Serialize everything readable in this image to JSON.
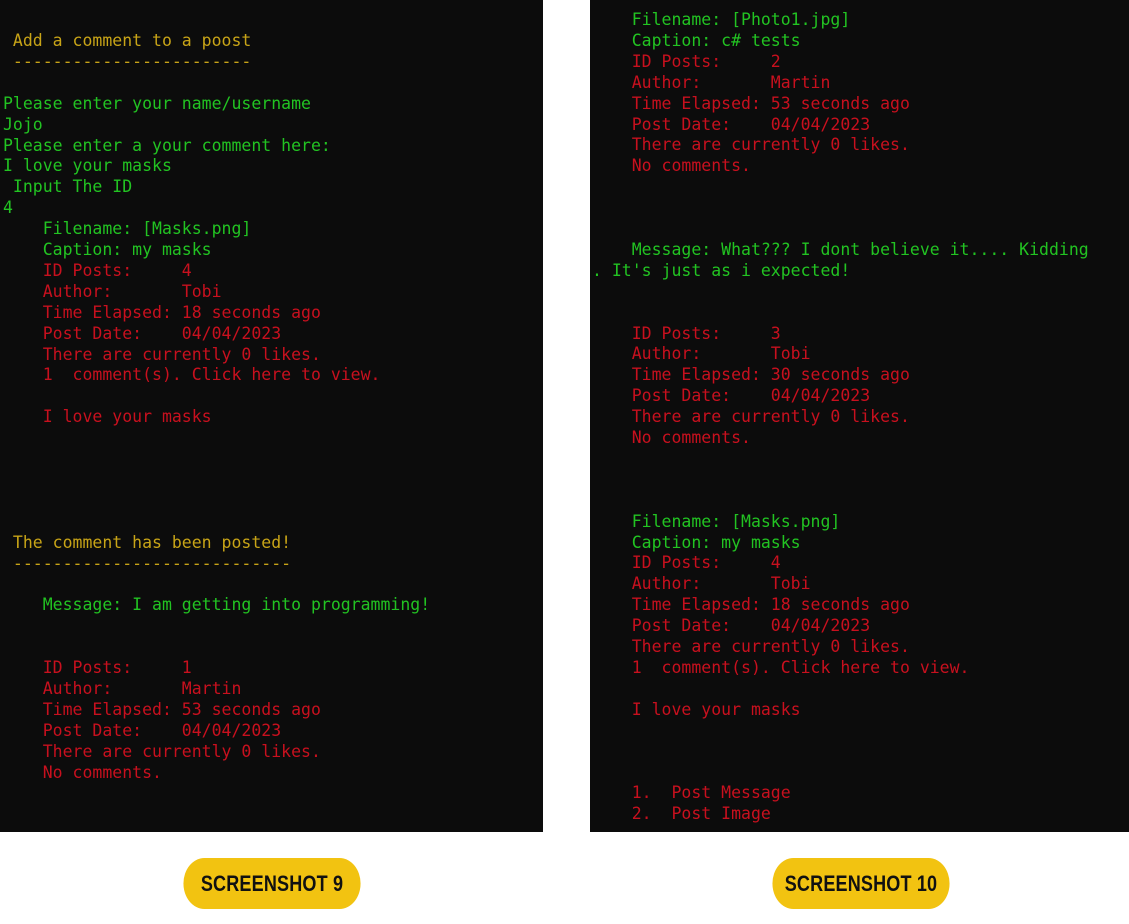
{
  "colors": {
    "console_background": "#0c0c0c",
    "heading": "#c8a417",
    "input_text": "#22c322",
    "post_text": "#c8101e",
    "badge": "#f2c311"
  },
  "screenshot9": {
    "label": "SCREENSHOT 9",
    "lines": [
      {
        "text": " Add a comment to a poost",
        "color": "yellow"
      },
      {
        "text": " ------------------------",
        "color": "yellow"
      },
      {
        "text": "",
        "color": "green"
      },
      {
        "text": "Please enter your name/username",
        "color": "green"
      },
      {
        "text": "Jojo",
        "color": "green"
      },
      {
        "text": "Please enter a your comment here:",
        "color": "green"
      },
      {
        "text": "I love your masks",
        "color": "green"
      },
      {
        "text": " Input The ID",
        "color": "green"
      },
      {
        "text": "4",
        "color": "green"
      },
      {
        "text": "    Filename: [Masks.png]",
        "color": "green"
      },
      {
        "text": "    Caption: my masks",
        "color": "green"
      },
      {
        "text": "    ID Posts:     4",
        "color": "red"
      },
      {
        "text": "    Author:       Tobi",
        "color": "red"
      },
      {
        "text": "    Time Elapsed: 18 seconds ago",
        "color": "red"
      },
      {
        "text": "    Post Date:    04/04/2023",
        "color": "red"
      },
      {
        "text": "    There are currently 0 likes.",
        "color": "red"
      },
      {
        "text": "    1  comment(s). Click here to view.",
        "color": "red"
      },
      {
        "text": "",
        "color": "red"
      },
      {
        "text": "    I love your masks",
        "color": "red"
      },
      {
        "text": "",
        "color": "red"
      },
      {
        "text": "",
        "color": "red"
      },
      {
        "text": "",
        "color": "red"
      },
      {
        "text": "",
        "color": "red"
      },
      {
        "text": "",
        "color": "red"
      },
      {
        "text": " The comment has been posted!",
        "color": "yellow"
      },
      {
        "text": " ----------------------------",
        "color": "yellow"
      },
      {
        "text": "",
        "color": "green"
      },
      {
        "text": "    Message: I am getting into programming!",
        "color": "green"
      },
      {
        "text": "",
        "color": "green"
      },
      {
        "text": "",
        "color": "green"
      },
      {
        "text": "    ID Posts:     1",
        "color": "red"
      },
      {
        "text": "    Author:       Martin",
        "color": "red"
      },
      {
        "text": "    Time Elapsed: 53 seconds ago",
        "color": "red"
      },
      {
        "text": "    Post Date:    04/04/2023",
        "color": "red"
      },
      {
        "text": "    There are currently 0 likes.",
        "color": "red"
      },
      {
        "text": "    No comments.",
        "color": "red"
      }
    ]
  },
  "screenshot10": {
    "label": "SCREENSHOT 10",
    "lines": [
      {
        "text": "    Filename: [Photo1.jpg]",
        "color": "green"
      },
      {
        "text": "    Caption: c# tests",
        "color": "green"
      },
      {
        "text": "    ID Posts:     2",
        "color": "red"
      },
      {
        "text": "    Author:       Martin",
        "color": "red"
      },
      {
        "text": "    Time Elapsed: 53 seconds ago",
        "color": "red"
      },
      {
        "text": "    Post Date:    04/04/2023",
        "color": "red"
      },
      {
        "text": "    There are currently 0 likes.",
        "color": "red"
      },
      {
        "text": "    No comments.",
        "color": "red"
      },
      {
        "text": "",
        "color": "red"
      },
      {
        "text": "",
        "color": "red"
      },
      {
        "text": "",
        "color": "red"
      },
      {
        "text": "    Message: What??? I dont believe it.... Kidding",
        "color": "green"
      },
      {
        "text": ". It's just as i expected!",
        "color": "green"
      },
      {
        "text": "",
        "color": "green"
      },
      {
        "text": "",
        "color": "green"
      },
      {
        "text": "    ID Posts:     3",
        "color": "red"
      },
      {
        "text": "    Author:       Tobi",
        "color": "red"
      },
      {
        "text": "    Time Elapsed: 30 seconds ago",
        "color": "red"
      },
      {
        "text": "    Post Date:    04/04/2023",
        "color": "red"
      },
      {
        "text": "    There are currently 0 likes.",
        "color": "red"
      },
      {
        "text": "    No comments.",
        "color": "red"
      },
      {
        "text": "",
        "color": "red"
      },
      {
        "text": "",
        "color": "red"
      },
      {
        "text": "",
        "color": "red"
      },
      {
        "text": "    Filename: [Masks.png]",
        "color": "green"
      },
      {
        "text": "    Caption: my masks",
        "color": "green"
      },
      {
        "text": "    ID Posts:     4",
        "color": "red"
      },
      {
        "text": "    Author:       Tobi",
        "color": "red"
      },
      {
        "text": "    Time Elapsed: 18 seconds ago",
        "color": "red"
      },
      {
        "text": "    Post Date:    04/04/2023",
        "color": "red"
      },
      {
        "text": "    There are currently 0 likes.",
        "color": "red"
      },
      {
        "text": "    1  comment(s). Click here to view.",
        "color": "red"
      },
      {
        "text": "",
        "color": "red"
      },
      {
        "text": "    I love your masks",
        "color": "red"
      },
      {
        "text": "",
        "color": "red"
      },
      {
        "text": "",
        "color": "red"
      },
      {
        "text": "",
        "color": "red"
      },
      {
        "text": "    1.  Post Message",
        "color": "red"
      },
      {
        "text": "    2.  Post Image",
        "color": "red"
      }
    ]
  }
}
